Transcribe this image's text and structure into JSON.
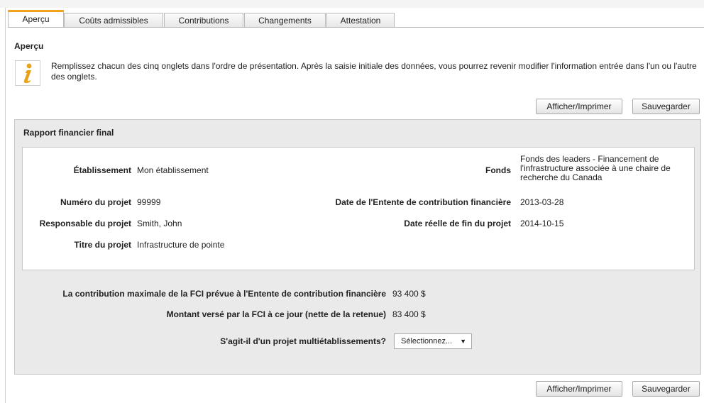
{
  "tabs": [
    {
      "label": "Aperçu",
      "active": true
    },
    {
      "label": "Coûts admissibles",
      "active": false
    },
    {
      "label": "Contributions",
      "active": false
    },
    {
      "label": "Changements",
      "active": false
    },
    {
      "label": "Attestation",
      "active": false
    }
  ],
  "overview": {
    "title": "Aperçu",
    "info_icon": "info-italic-i-icon",
    "instructions": "Remplissez chacun des cinq onglets dans l'ordre de présentation. Après la saisie initiale des données, vous pourrez revenir modifier l'information entrée dans l'un ou l'autre des onglets."
  },
  "actions": {
    "print_label": "Afficher/Imprimer",
    "save_label": "Sauvegarder"
  },
  "report": {
    "title": "Rapport financier final",
    "fields": {
      "institution_label": "Établissement",
      "institution_value": "Mon établissement",
      "fund_label": "Fonds",
      "fund_value": "Fonds des leaders - Financement de l'infrastructure associée à une chaire de recherche du Canada",
      "project_number_label": "Numéro du projet",
      "project_number_value": "99999",
      "agreement_date_label": "Date de l'Entente de contribution financière",
      "agreement_date_value": "2013-03-28",
      "project_lead_label": "Responsable du projet",
      "project_lead_value": "Smith, John",
      "end_date_label": "Date réelle de fin du projet",
      "end_date_value": "2014-10-15",
      "project_title_label": "Titre du projet",
      "project_title_value": "Infrastructure de pointe"
    },
    "max_contribution_label": "La contribution maximale de la FCI prévue à l'Entente de contribution financière",
    "max_contribution_value": "93 400 $",
    "paid_label": "Montant versé par la FCI à ce jour (nette de la retenue)",
    "paid_value": "83 400 $",
    "multi_label": "S'agit-il d'un projet multiétablissements?",
    "multi_select": "Sélectionnez...",
    "multi_arrow": "▼"
  },
  "colors": {
    "active_tab_accent": "#f0a21b",
    "info_icon": "#e9a11a",
    "panel_bg": "#eaeaea"
  }
}
